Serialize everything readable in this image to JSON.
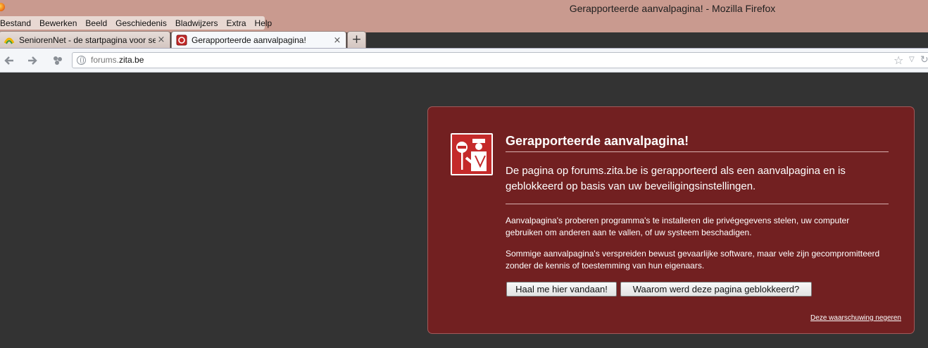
{
  "window": {
    "title": "Gerapporteerde aanvalpagina! - Mozilla Firefox"
  },
  "menubar": {
    "items": [
      "Bestand",
      "Bewerken",
      "Beeld",
      "Geschiedenis",
      "Bladwijzers",
      "Extra",
      "Help"
    ]
  },
  "tabs": [
    {
      "label": "SeniorenNet - de startpagina voor se...",
      "close": "×",
      "icon": "seniorennet-favicon",
      "active": false
    },
    {
      "label": "Gerapporteerde aanvalpagina!",
      "close": "×",
      "icon": "blocked-favicon",
      "active": true
    }
  ],
  "newtab": {
    "label": "+"
  },
  "navbar": {
    "back": "🡐",
    "forward": "🡒",
    "url_prefix": "forums.",
    "url_domain": "zita.be"
  },
  "warning": {
    "title": "Gerapporteerde aanvalpagina!",
    "short_desc": "De pagina op forums.zita.be is gerapporteerd als een aanvalpagina en is geblokkeerd op basis van uw beveiligingsinstellingen.",
    "long_desc_1": "Aanvalpagina's proberen programma's te installeren die privégegevens stelen, uw computer gebruiken om anderen aan te vallen, of uw systeem beschadigen.",
    "long_desc_2": "Sommige aanvalpagina's verspreiden bewust gevaarlijke software, maar vele zijn gecompromitteerd zonder de kennis of toestemming van hun eigenaars.",
    "get_me_out": "Haal me hier vandaan!",
    "why_blocked": "Waarom werd deze pagina geblokkeerd?",
    "ignore": "Deze waarschuwing negeren"
  },
  "colors": {
    "titlebar": "#c99a8f",
    "content_bg": "#333333",
    "warning_bg": "#722021"
  }
}
